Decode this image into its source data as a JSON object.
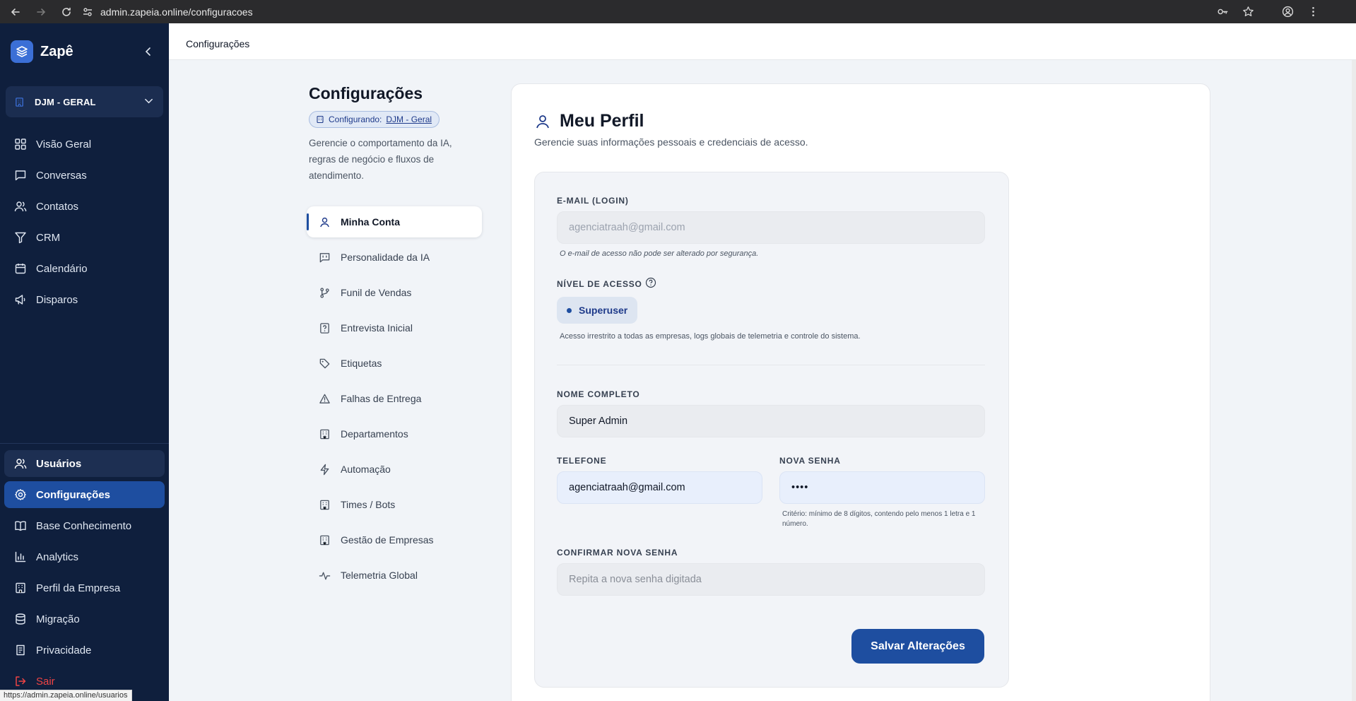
{
  "browser": {
    "url": "admin.zapeia.online/configuracoes",
    "status_url": "https://admin.zapeia.online/usuarios"
  },
  "sidebar": {
    "brand": "Zapê",
    "company": "DJM - GERAL",
    "items": [
      {
        "label": "Visão Geral",
        "icon": "grid-icon"
      },
      {
        "label": "Conversas",
        "icon": "chat-icon"
      },
      {
        "label": "Contatos",
        "icon": "users-icon"
      },
      {
        "label": "CRM",
        "icon": "filter-icon"
      },
      {
        "label": "Calendário",
        "icon": "calendar-icon"
      },
      {
        "label": "Disparos",
        "icon": "megaphone-icon"
      }
    ],
    "bottom_items": [
      {
        "label": "Usuários",
        "icon": "users-icon"
      },
      {
        "label": "Configurações",
        "icon": "gear-icon"
      },
      {
        "label": "Base Conhecimento",
        "icon": "book-icon"
      },
      {
        "label": "Analytics",
        "icon": "bar-chart-icon"
      },
      {
        "label": "Perfil da Empresa",
        "icon": "building-icon"
      },
      {
        "label": "Migração",
        "icon": "database-icon"
      },
      {
        "label": "Privacidade",
        "icon": "note-icon"
      },
      {
        "label": "Sair",
        "icon": "logout-icon"
      }
    ]
  },
  "topbar": {
    "title": "Configurações"
  },
  "settings": {
    "title": "Configurações",
    "configuring_label": "Configurando:",
    "configuring_value": "DJM - Geral",
    "description": "Gerencie o comportamento da IA, regras de negócio e fluxos de atendimento.",
    "nav": [
      {
        "label": "Minha Conta",
        "icon": "user-icon"
      },
      {
        "label": "Personalidade da IA",
        "icon": "bot-message-icon"
      },
      {
        "label": "Funil de Vendas",
        "icon": "git-branch-icon"
      },
      {
        "label": "Entrevista Inicial",
        "icon": "question-file-icon"
      },
      {
        "label": "Etiquetas",
        "icon": "tag-icon"
      },
      {
        "label": "Falhas de Entrega",
        "icon": "warning-icon"
      },
      {
        "label": "Departamentos",
        "icon": "building-icon"
      },
      {
        "label": "Automação",
        "icon": "lightning-icon"
      },
      {
        "label": "Times / Bots",
        "icon": "building-icon"
      },
      {
        "label": "Gestão de Empresas",
        "icon": "building-icon"
      },
      {
        "label": "Telemetria Global",
        "icon": "activity-icon"
      }
    ]
  },
  "profile": {
    "title": "Meu Perfil",
    "subtitle": "Gerencie suas informações pessoais e credenciais de acesso.",
    "email_label": "E-MAIL (LOGIN)",
    "email_value": "agenciatraah@gmail.com",
    "email_hint": "O e-mail de acesso não pode ser alterado por segurança.",
    "access_label": "NÍVEL DE ACESSO",
    "access_value": "Superuser",
    "access_hint": "Acesso irrestrito a todas as empresas, logs globais de telemetria e controle do sistema.",
    "name_label": "NOME COMPLETO",
    "name_value": "Super Admin",
    "phone_label": "TELEFONE",
    "phone_value": "agenciatraah@gmail.com",
    "password_label": "NOVA SENHA",
    "password_value": "••••",
    "password_hint_1": "Critério: mínimo de 8 dígitos, contendo pelo menos 1 letra e 1",
    "password_hint_2": "número.",
    "confirm_label": "CONFIRMAR NOVA SENHA",
    "confirm_placeholder": "Repita a nova senha digitada",
    "save_label": "Salvar Alterações"
  },
  "colors": {
    "sidebar_bg": "#0f1f3d",
    "accent": "#1e4ea0",
    "logout": "#ef4444"
  }
}
